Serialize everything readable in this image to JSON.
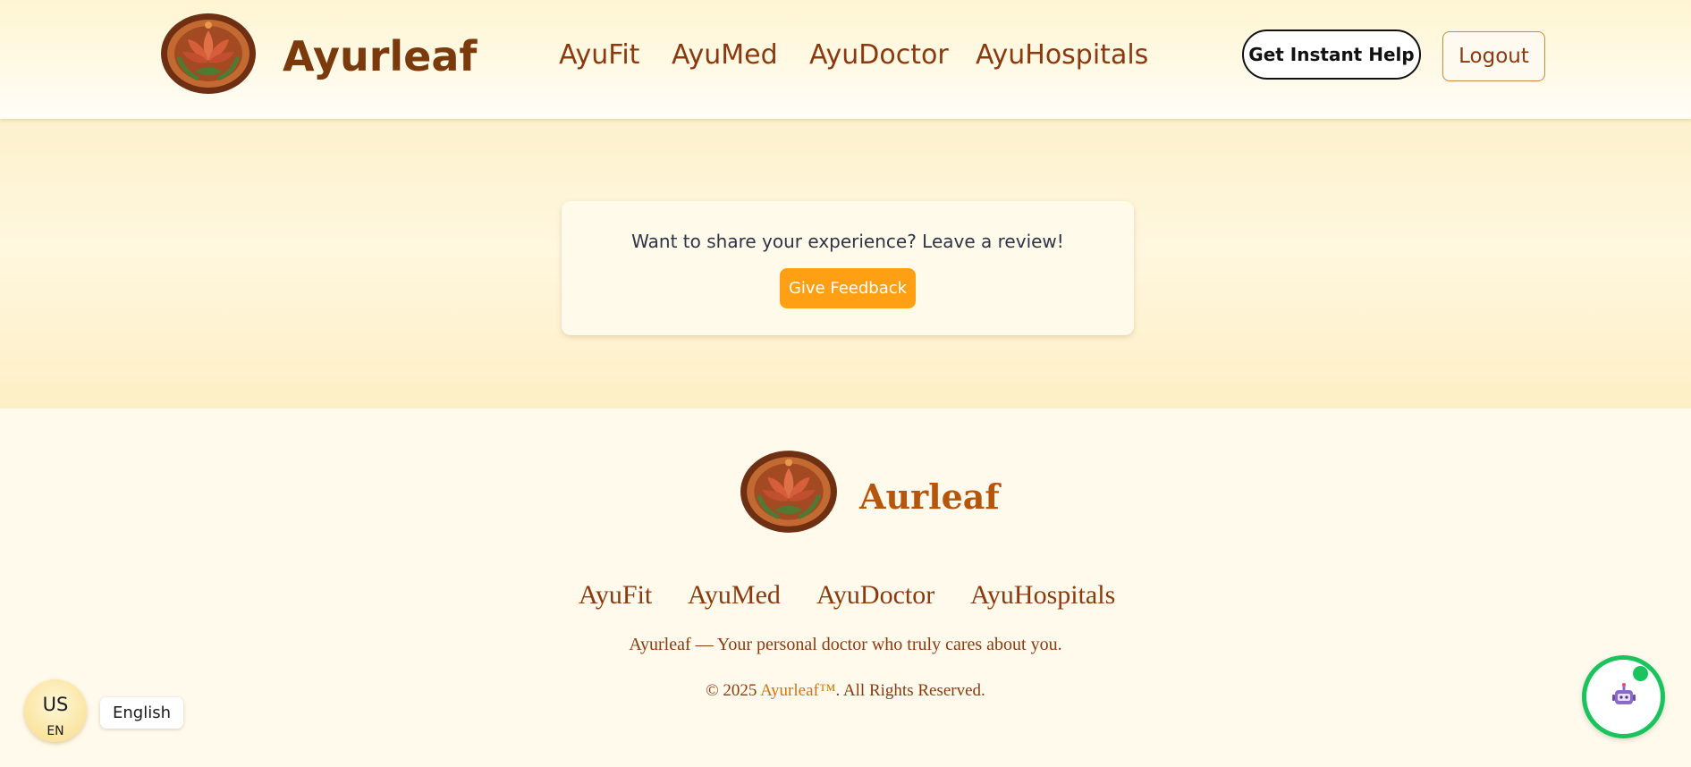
{
  "header": {
    "brand": "Ayurleaf",
    "logo_icon": "lotus-emblem-icon",
    "nav": [
      "AyuFit",
      "AyuMed",
      "AyuDoctor",
      "AyuHospitals"
    ],
    "instant_help_label": "Get Instant Help",
    "logout_label": "Logout"
  },
  "review": {
    "prompt": "Want to share your experience? Leave a review!",
    "button_label": "Give Feedback"
  },
  "footer": {
    "brand": "Aurleaf",
    "nav": [
      "AyuFit",
      "AyuMed",
      "AyuDoctor",
      "AyuHospitals"
    ],
    "tagline": "Ayurleaf — Your personal doctor who truly cares about you.",
    "copyright_prefix": "© 2025 ",
    "copyright_brand": "Ayurleaf™",
    "copyright_suffix": ". All Rights Reserved."
  },
  "language": {
    "code": "US",
    "sub": "EN",
    "label": "English"
  },
  "chatbot": {
    "icon": "robot-icon"
  },
  "colors": {
    "brand_brown": "#7a3a0c",
    "accent_orange": "#ffa014",
    "online_green": "#19c45d"
  }
}
